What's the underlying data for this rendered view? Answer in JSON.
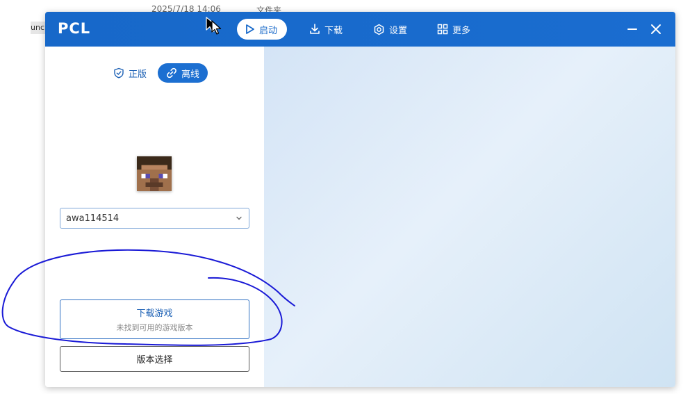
{
  "desktop": {
    "timestamp": "2025/7/18 14:06",
    "folder_label": "文件夹",
    "left_fragment": "unc"
  },
  "window": {
    "title": "PCL",
    "nav": [
      {
        "label": "启动",
        "icon": "play-icon",
        "active": true
      },
      {
        "label": "下载",
        "icon": "download-icon",
        "active": false
      },
      {
        "label": "设置",
        "icon": "gear-icon",
        "active": false
      },
      {
        "label": "更多",
        "icon": "grid-icon",
        "active": false
      }
    ],
    "controls": {
      "minimize": "minimize-icon",
      "close": "close-icon"
    }
  },
  "sidebar": {
    "auth_tabs": [
      {
        "label": "正版",
        "icon": "shield-check-icon",
        "active": false
      },
      {
        "label": "离线",
        "icon": "link-icon",
        "active": true
      }
    ],
    "username": "awa114514",
    "download_button": {
      "title": "下载游戏",
      "subtitle": "未找到可用的游戏版本"
    },
    "version_button": "版本选择"
  },
  "colors": {
    "accent": "#1768c9",
    "annotation": "#1a1ad6"
  }
}
